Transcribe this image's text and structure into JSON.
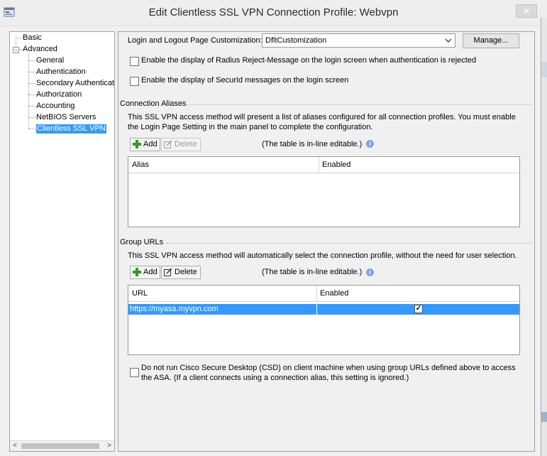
{
  "window": {
    "title": "Edit Clientless SSL VPN Connection Profile: Webvpn",
    "close_glyph": "✕"
  },
  "tree": {
    "items": [
      {
        "label": "Basic"
      },
      {
        "label": "Advanced"
      },
      {
        "label": "General"
      },
      {
        "label": "Authentication"
      },
      {
        "label": "Secondary Authenticat"
      },
      {
        "label": "Authorization"
      },
      {
        "label": "Accounting"
      },
      {
        "label": "NetBIOS Servers"
      },
      {
        "label": "Clientless SSL VPN"
      }
    ],
    "expander_glyph": "−",
    "scroll_left": "<",
    "scroll_right": ">"
  },
  "customization": {
    "label": "Login and Logout Page Customization:",
    "selected": "DfltCustomization",
    "manage_label": "Manage..."
  },
  "options": {
    "radius_reject": "Enable the display of Radius Reject-Message on the login screen when authentication is rejected",
    "securid": "Enable the display of SecurId messages on the login screen"
  },
  "connection_aliases": {
    "title": "Connection Aliases",
    "description": "This SSL VPN access method will present a list of aliases configured for all connection profiles. You must enable the Login Page Setting in the main panel to complete the configuration.",
    "add_label": "Add",
    "delete_label": "Delete",
    "inline_note": "(The table is in-line editable.)",
    "columns": [
      "Alias",
      "Enabled"
    ],
    "rows": []
  },
  "group_urls": {
    "title": "Group URLs",
    "description": "This SSL VPN access method will automatically select the connection profile, without the need for user selection.",
    "add_label": "Add",
    "delete_label": "Delete",
    "inline_note": "(The table is in-line editable.)",
    "columns": [
      "URL",
      "Enabled"
    ],
    "rows": [
      {
        "url": "https://myasa.myvpn.com",
        "enabled": true,
        "check_glyph": "✓"
      }
    ]
  },
  "csd_option": {
    "label": "Do not run Cisco Secure Desktop (CSD) on client machine when using group URLs defined above to access the ASA. (If a client connects using a connection alias, this setting is ignored.)"
  },
  "colors": {
    "selection": "#3399ff",
    "add_icon": "#2e9b2e",
    "info_icon": "#7aa7e0"
  }
}
